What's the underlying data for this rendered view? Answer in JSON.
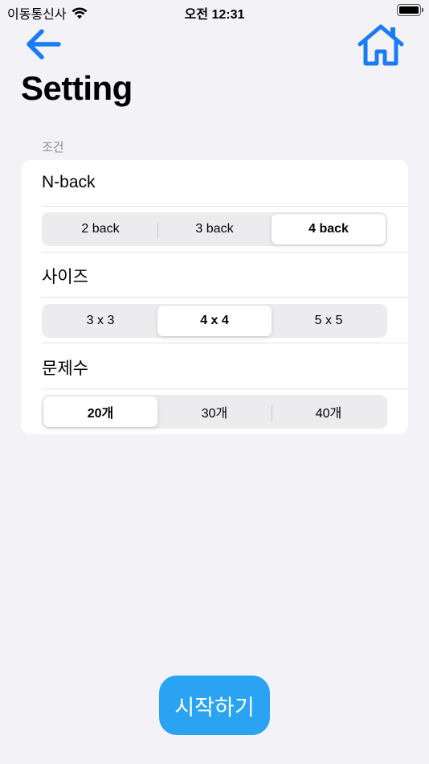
{
  "status_bar": {
    "carrier": "이동통신사",
    "time": "오전 12:31",
    "wifi_icon": "wifi-icon",
    "battery_icon": "battery-icon"
  },
  "nav": {
    "back_icon": "arrow-left-icon",
    "home_icon": "house-icon",
    "accent_color": "#1a7cf5"
  },
  "page_title": "Setting",
  "section": {
    "header": "조건",
    "rows": [
      {
        "label": "N-back",
        "options": [
          "2 back",
          "3 back",
          "4 back"
        ],
        "selected_index": 2
      },
      {
        "label": "사이즈",
        "options": [
          "3 x 3",
          "4 x 4",
          "5 x 5"
        ],
        "selected_index": 1
      },
      {
        "label": "문제수",
        "options": [
          "20개",
          "30개",
          "40개"
        ],
        "selected_index": 0
      }
    ]
  },
  "start_button": {
    "label": "시작하기",
    "color": "#2aa3f3"
  }
}
